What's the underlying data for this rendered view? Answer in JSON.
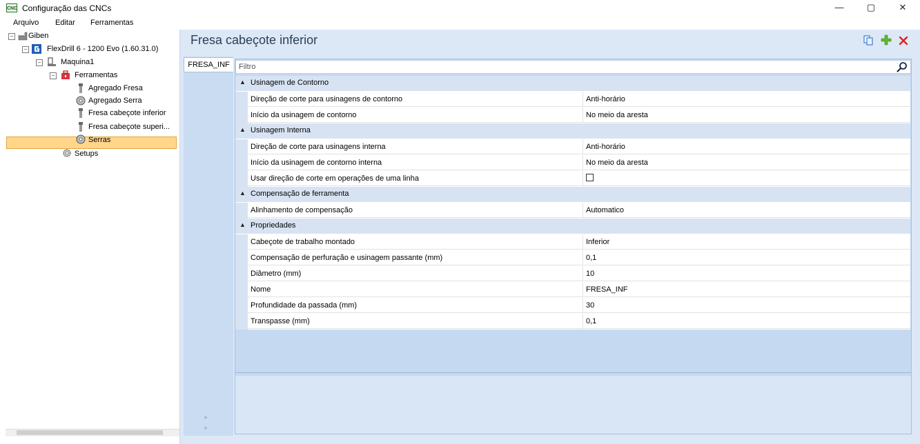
{
  "window": {
    "title": "Configuração das CNCs",
    "app_icon": "CNC",
    "min": "—",
    "max": "▢",
    "close": "✕"
  },
  "menu": [
    "Arquivo",
    "Editar",
    "Ferramentas"
  ],
  "tree": {
    "root": "Giben",
    "machine_model": "FlexDrill 6 - 1200 Evo (1.60.31.0)",
    "machine": "Maquina1",
    "tools_folder": "Ferramentas",
    "tools": [
      "Agregado Fresa",
      "Agregado Serra",
      "Fresa cabeçote inferior",
      "Fresa cabeçote superi...",
      "Serras"
    ],
    "setups": "Setups",
    "selected": "Fresa cabeçote inferior"
  },
  "panel": {
    "title": "Fresa cabeçote inferior",
    "tab": "FRESA_INF",
    "filter_placeholder": "Filtro"
  },
  "properties": [
    {
      "category": "Usinagem de Contorno",
      "rows": [
        {
          "name": "Direção de corte para usinagens de contorno",
          "value": "Anti-horário"
        },
        {
          "name": "Início da usinagem de contorno",
          "value": "No meio da aresta"
        }
      ]
    },
    {
      "category": "Usinagem Interna",
      "rows": [
        {
          "name": "Direção de corte para usinagens interna",
          "value": "Anti-horário"
        },
        {
          "name": "Início da usinagem de contorno interna",
          "value": "No meio da aresta"
        },
        {
          "name": "Usar direção de corte em operações de uma linha",
          "value": ""
        }
      ]
    },
    {
      "category": "Compensação de ferramenta",
      "rows": [
        {
          "name": "Alinhamento de compensação",
          "value": "Automatico"
        }
      ]
    },
    {
      "category": "Propriedades",
      "rows": [
        {
          "name": "Cabeçote de trabalho montado",
          "value": "Inferior"
        },
        {
          "name": "Compensação de perfuração e usinagem passante (mm)",
          "value": "0,1"
        },
        {
          "name": "Diâmetro (mm)",
          "value": "10"
        },
        {
          "name": "Nome",
          "value": "FRESA_INF"
        },
        {
          "name": "Profundidade da passada (mm)",
          "value": "30"
        },
        {
          "name": "Transpasse (mm)",
          "value": "0,1"
        }
      ]
    }
  ],
  "colors": {
    "selected_bg": "#ffd68a",
    "category_bg": "#d7e3f2",
    "panel_bg": "#dce8f6",
    "add_icon": "#5cb82e",
    "delete_icon": "#e02020"
  }
}
